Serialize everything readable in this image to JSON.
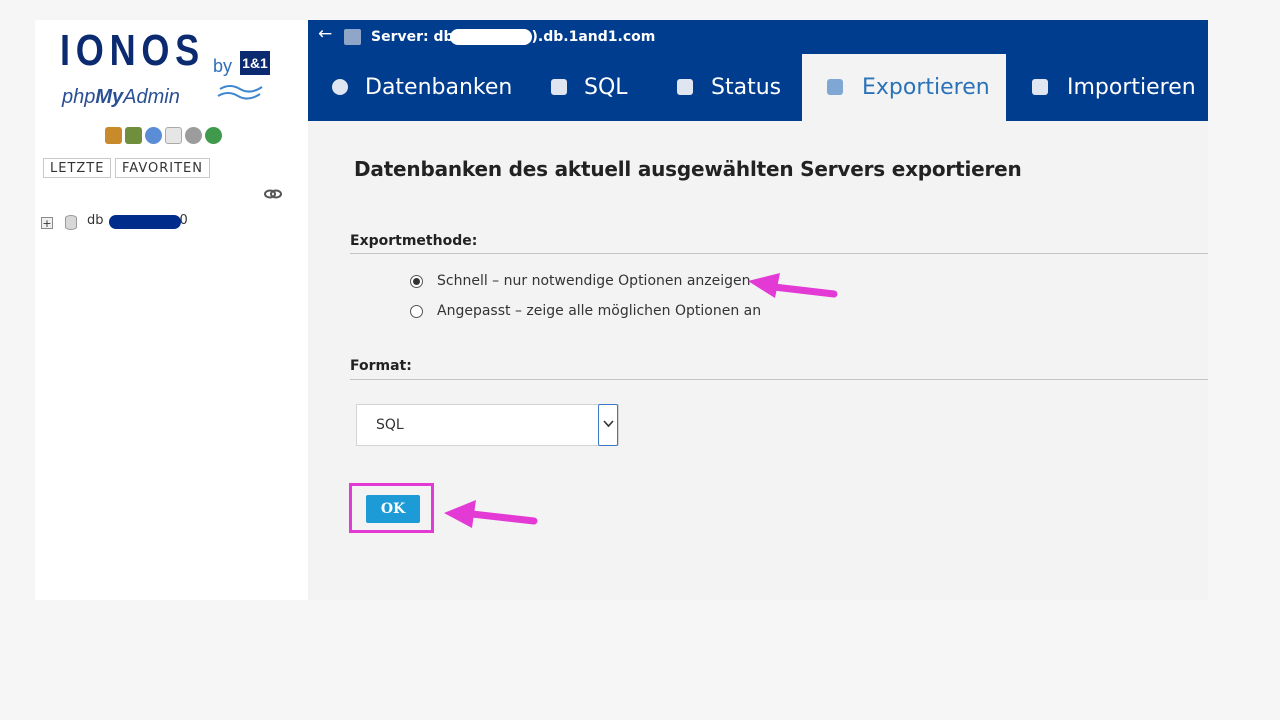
{
  "sidebar": {
    "logo": {
      "brand": "IONOS",
      "by": "by",
      "partner": "1&1",
      "product_prefix": "php",
      "product_mid": "My",
      "product_suffix": "Admin"
    },
    "quick_icons": [
      "home-icon",
      "logout-icon",
      "help-icon",
      "docs-icon",
      "settings-icon",
      "reload-icon"
    ],
    "tabs": {
      "recent": "LETZTE",
      "favorites": "FAVORITEN"
    },
    "link_icon": "chain-link-icon",
    "db_tree": {
      "db_name_visible": "db",
      "db_name_suffix": "0"
    }
  },
  "header": {
    "server_label": "Server: db",
    "server_suffix": ").db.1and1.com"
  },
  "navtabs": [
    {
      "label": "Datenbanken",
      "icon": "database-icon"
    },
    {
      "label": "SQL",
      "icon": "sql-icon"
    },
    {
      "label": "Status",
      "icon": "status-icon"
    },
    {
      "label": "Exportieren",
      "icon": "export-icon",
      "active": true
    },
    {
      "label": "Importieren",
      "icon": "import-icon"
    }
  ],
  "main": {
    "title": "Datenbanken des aktuell ausgewählten Servers exportieren",
    "export_method": {
      "label": "Exportmethode:",
      "options": [
        {
          "label": "Schnell – nur notwendige Optionen anzeigen",
          "checked": true
        },
        {
          "label": "Angepasst – zeige alle möglichen Optionen an",
          "checked": false
        }
      ]
    },
    "format": {
      "label": "Format:",
      "selected": "SQL"
    },
    "ok_label": "OK"
  },
  "colors": {
    "nav_blue": "#003d8f",
    "active_tab_text": "#2a73b8",
    "ok_button": "#1d9bd7",
    "highlight_pink": "#e33ad6"
  }
}
